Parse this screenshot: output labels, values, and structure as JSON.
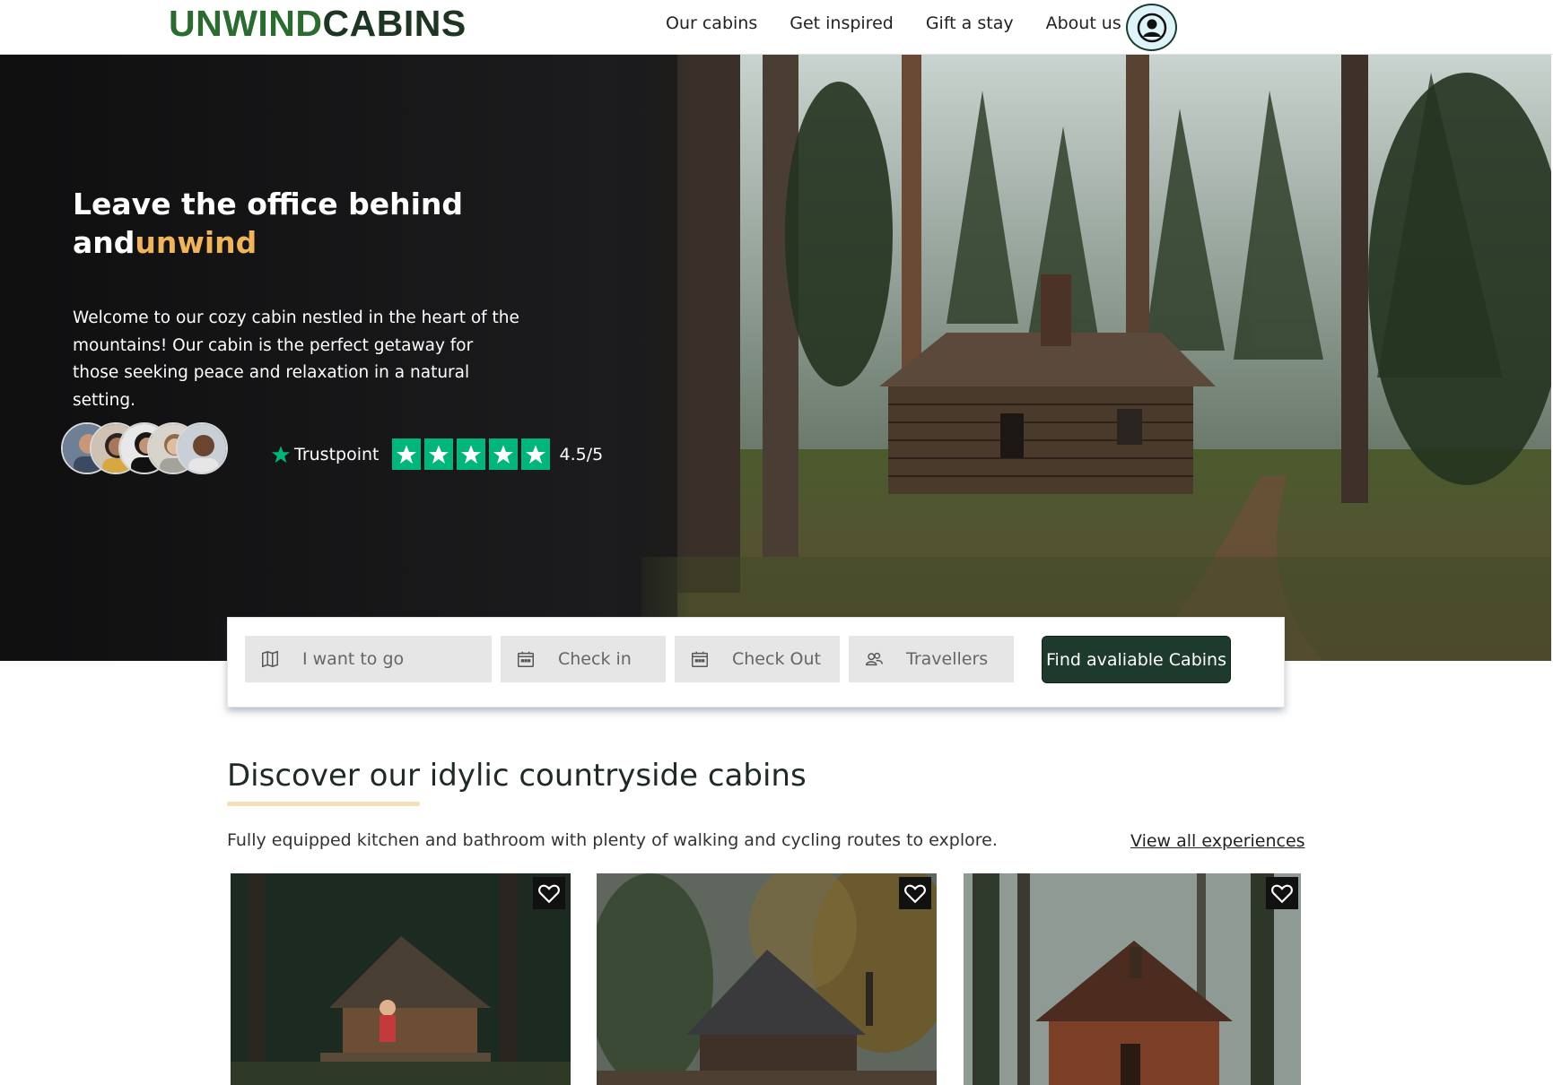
{
  "brand": {
    "part1": "UNWIND",
    "part2": "CABINS",
    "color_primary": "#2c6b2f",
    "color_dark": "#1f3524"
  },
  "nav": {
    "links": [
      "Our cabins",
      "Get inspired",
      "Gift a stay",
      "About us"
    ],
    "account_icon": "user-circle-icon"
  },
  "hero": {
    "title_line1": "Leave the office behind",
    "title_line2_a": "and",
    "title_line2_b": "unwind",
    "accent_color": "#f0b45a",
    "description": "Welcome to our cozy cabin nestled in the heart of the mountains! Our cabin is the perfect getaway for those seeking peace and relaxation in a natural setting.",
    "trust_label": "Trustpoint",
    "rating": "4.5/5",
    "stars": 5,
    "star_color": "#00b67a"
  },
  "search": {
    "destination_placeholder": "I want to go",
    "checkin_placeholder": "Check in",
    "checkout_placeholder": "Check Out",
    "travellers_placeholder": "Travellers",
    "submit_label": "Find avaliable Cabins"
  },
  "discover": {
    "title": "Discover our idylic countryside cabins",
    "subtitle": "Fully equipped kitchen and bathroom with plenty of walking and cycling routes to explore.",
    "view_all": "View all experiences",
    "cards": [
      {
        "icon": "heart-icon"
      },
      {
        "icon": "heart-icon"
      },
      {
        "icon": "heart-icon"
      }
    ]
  }
}
